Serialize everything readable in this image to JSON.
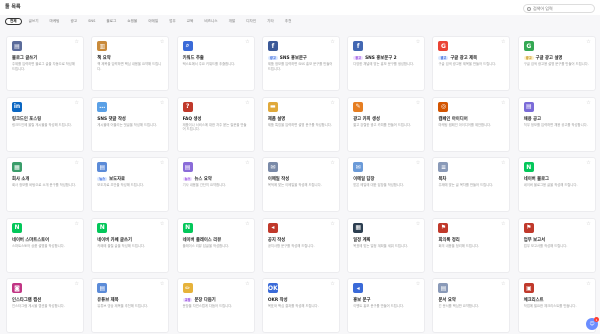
{
  "app": {
    "title": "툴 목록"
  },
  "search": {
    "placeholder": "검색어 입력"
  },
  "tabs": [
    {
      "label": "전체",
      "active": true
    },
    {
      "label": "글쓰기"
    },
    {
      "label": "마케팅"
    },
    {
      "label": "광고"
    },
    {
      "label": "SNS"
    },
    {
      "label": "블로그"
    },
    {
      "label": "쇼핑몰"
    },
    {
      "label": "이메일"
    },
    {
      "label": "업무"
    },
    {
      "label": "교육"
    },
    {
      "label": "비즈니스"
    },
    {
      "label": "개발"
    },
    {
      "label": "디자인"
    },
    {
      "label": "기타"
    },
    {
      "label": "추천"
    }
  ],
  "cards": [
    {
      "icon": "doc",
      "color": "#5b6b9a",
      "title": "블로그 글쓰기",
      "tag": "",
      "tagColor": "",
      "desc": "주제를 입력하면 블로그 글을 자동으로 작성해 드립니다."
    },
    {
      "icon": "book",
      "color": "#c98a3a",
      "title": "책 요약",
      "tag": "",
      "tagColor": "",
      "desc": "책 제목을 입력하면 핵심 내용을 요약해 드립니다."
    },
    {
      "icon": "search",
      "color": "#3a6ad8",
      "title": "키워드 추출",
      "tag": "",
      "tagColor": "",
      "desc": "텍스트에서 주요 키워드를 추출합니다."
    },
    {
      "icon": "fb",
      "color": "#3b5998",
      "title": "SNS 홍보문구",
      "tag": "광고",
      "tagColor": "blue",
      "desc": "제품 정보를 입력하면 SNS 홍보 문구를 만들어 드립니다."
    },
    {
      "icon": "fb",
      "color": "#4267b2",
      "title": "SNS 홍보문구 2",
      "tag": "광고",
      "tagColor": "purple",
      "desc": "다양한 채널에 맞는 홍보 문구를 생성합니다."
    },
    {
      "icon": "G",
      "color": "#ea4335",
      "title": "구글 광고 제목",
      "tag": "광고",
      "tagColor": "blue",
      "desc": "구글 검색 광고용 제목을 만들어 드립니다."
    },
    {
      "icon": "G",
      "color": "#34a853",
      "title": "구글 광고 설명",
      "tag": "광고",
      "tagColor": "yellow",
      "desc": "구글 검색 광고용 설명 문구를 만들어 드립니다."
    },
    {
      "icon": "in",
      "color": "#0a66c2",
      "title": "링크드인 포스팅",
      "tag": "",
      "tagColor": "",
      "desc": "링크드인에 올릴 게시물을 작성해 드립니다."
    },
    {
      "icon": "chat",
      "color": "#5aa0e6",
      "title": "SNS 댓글 작성",
      "tag": "",
      "tagColor": "",
      "desc": "게시물에 어울리는 댓글을 작성해 드립니다."
    },
    {
      "icon": "?",
      "color": "#c0392b",
      "title": "FAQ 생성",
      "tag": "",
      "tagColor": "",
      "desc": "제품이나 서비스에 대한 자주 묻는 질문을 만들어 드립니다."
    },
    {
      "icon": "box",
      "color": "#e0a93b",
      "title": "제품 설명",
      "tag": "",
      "tagColor": "",
      "desc": "제품 특징을 입력하면 설명 문구를 작성합니다."
    },
    {
      "icon": "pen",
      "color": "#e67e22",
      "title": "광고 카피 생성",
      "tag": "",
      "tagColor": "",
      "desc": "짧고 강렬한 광고 카피를 만들어 드립니다."
    },
    {
      "icon": "target",
      "color": "#d35400",
      "title": "캠페인 아이디어",
      "tag": "",
      "tagColor": "",
      "desc": "마케팅 캠페인 아이디어를 제안합니다."
    },
    {
      "icon": "doc",
      "color": "#7a6bd8",
      "title": "채용 공고",
      "tag": "",
      "tagColor": "",
      "desc": "직무 정보를 입력하면 채용 공고를 작성합니다."
    },
    {
      "icon": "chart",
      "color": "#3a9d6a",
      "title": "회사 소개",
      "tag": "",
      "tagColor": "",
      "desc": "회사 정보를 바탕으로 소개 문구를 작성합니다."
    },
    {
      "icon": "doc",
      "color": "#5b8bd8",
      "title": "보도자료",
      "tag": "뉴스",
      "tagColor": "blue",
      "desc": "보도자료 초안을 작성해 드립니다."
    },
    {
      "icon": "doc",
      "color": "#8a6bd8",
      "title": "뉴스 요약",
      "tag": "뉴스",
      "tagColor": "purple",
      "desc": "기사 내용을 간단히 요약합니다."
    },
    {
      "icon": "mail",
      "color": "#7a8aa8",
      "title": "이메일 작성",
      "tag": "",
      "tagColor": "",
      "desc": "목적에 맞는 이메일을 작성해 드립니다."
    },
    {
      "icon": "mail",
      "color": "#6a9ad8",
      "title": "이메일 답장",
      "tag": "",
      "tagColor": "",
      "desc": "받은 메일에 대한 답장을 작성합니다."
    },
    {
      "icon": "list",
      "color": "#8a9ab8",
      "title": "목차",
      "tag": "",
      "tagColor": "",
      "desc": "주제에 맞는 글 목차를 만들어 드립니다."
    },
    {
      "icon": "N",
      "color": "#03c75a",
      "title": "네이버 블로그",
      "tag": "",
      "tagColor": "",
      "desc": "네이버 블로그용 글을 작성해 드립니다."
    },
    {
      "icon": "N",
      "color": "#03c75a",
      "title": "네이버 스마트스토어",
      "tag": "",
      "tagColor": "",
      "desc": "스마트스토어 상품 설명을 작성합니다."
    },
    {
      "icon": "N",
      "color": "#03c75a",
      "title": "네이버 카페 글쓰기",
      "tag": "",
      "tagColor": "",
      "desc": "카페에 올릴 글을 작성해 드립니다."
    },
    {
      "icon": "N",
      "color": "#03c75a",
      "title": "네이버 플레이스 리뷰",
      "tag": "",
      "tagColor": "",
      "desc": "플레이스 리뷰 답글을 작성합니다."
    },
    {
      "icon": "mega",
      "color": "#c0392b",
      "title": "공지 작성",
      "tag": "",
      "tagColor": "",
      "desc": "공지사항 문구를 작성해 드립니다."
    },
    {
      "icon": "cal",
      "color": "#2c3e50",
      "title": "일정 계획",
      "tag": "",
      "tagColor": "",
      "desc": "목표에 맞는 일정 계획을 세워 드립니다."
    },
    {
      "icon": "flag",
      "color": "#c0392b",
      "title": "회의록 정리",
      "tag": "",
      "tagColor": "",
      "desc": "회의 내용을 정리해 드립니다."
    },
    {
      "icon": "flag",
      "color": "#c0392b",
      "title": "업무 보고서",
      "tag": "",
      "tagColor": "",
      "desc": "업무 보고서를 작성해 드립니다."
    },
    {
      "icon": "ig",
      "color": "#c13584",
      "title": "인스타그램 캡션",
      "tag": "",
      "tagColor": "",
      "desc": "인스타그램 게시물 캡션을 작성합니다."
    },
    {
      "icon": "doc",
      "color": "#5b8bd8",
      "title": "유튜브 제목",
      "tag": "",
      "tagColor": "",
      "desc": "유튜브 영상 제목을 추천해 드립니다."
    },
    {
      "icon": "pencil",
      "color": "#e6b23a",
      "title": "문장 다듬기",
      "tag": "교정",
      "tagColor": "purple",
      "desc": "문장을 자연스럽게 다듬어 드립니다."
    },
    {
      "icon": "okr",
      "color": "#3a6ad8",
      "title": "OKR 작성",
      "tag": "",
      "tagColor": "",
      "desc": "목표와 핵심 결과를 작성해 드립니다."
    },
    {
      "icon": "mega",
      "color": "#3a6ad8",
      "title": "홍보 문구",
      "tag": "",
      "tagColor": "",
      "desc": "이벤트 홍보 문구를 만들어 드립니다."
    },
    {
      "icon": "doc",
      "color": "#8a9ab8",
      "title": "문서 요약",
      "tag": "",
      "tagColor": "",
      "desc": "긴 문서를 핵심만 요약합니다."
    },
    {
      "icon": "clip",
      "color": "#c0392b",
      "title": "체크리스트",
      "tag": "",
      "tagColor": "",
      "desc": "작업에 필요한 체크리스트를 만듭니다."
    }
  ],
  "help": {
    "badge": "1"
  }
}
